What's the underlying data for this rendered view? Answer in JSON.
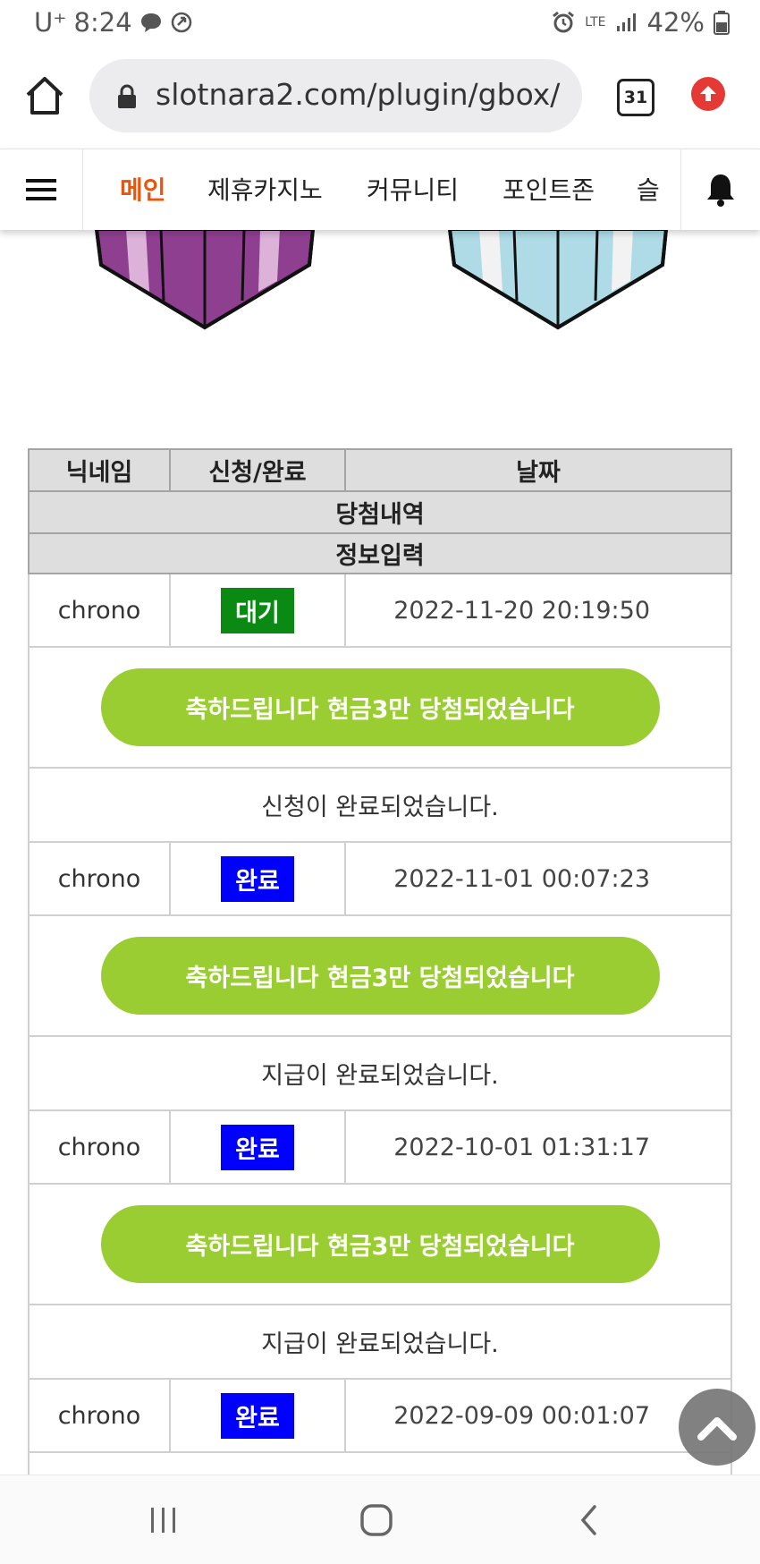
{
  "status_bar": {
    "carrier": "U⁺",
    "time": "8:24",
    "network": "LTE",
    "battery": "42%"
  },
  "browser": {
    "url": "slotnara2.com/plugin/gbox/",
    "tab_count": "31"
  },
  "nav": {
    "items": [
      "메인",
      "제휴카지노",
      "커뮤니티",
      "포인트존",
      "슬"
    ],
    "active_index": 0
  },
  "table": {
    "headers": {
      "nickname": "닉네임",
      "status": "신청/완료",
      "date": "날짜",
      "history": "당첨내역",
      "info": "정보입력"
    },
    "entries": [
      {
        "nickname": "chrono",
        "status": "대기",
        "status_type": "wait",
        "date": "2022-11-20 20:19:50",
        "prize": "축하드립니다 현금3만 당첨되었습니다",
        "message": "신청이 완료되었습니다."
      },
      {
        "nickname": "chrono",
        "status": "완료",
        "status_type": "done",
        "date": "2022-11-01 00:07:23",
        "prize": "축하드립니다 현금3만 당첨되었습니다",
        "message": "지급이 완료되었습니다."
      },
      {
        "nickname": "chrono",
        "status": "완료",
        "status_type": "done",
        "date": "2022-10-01 01:31:17",
        "prize": "축하드립니다 현금3만 당첨되었습니다",
        "message": "지급이 완료되었습니다."
      },
      {
        "nickname": "chrono",
        "status": "완료",
        "status_type": "done",
        "date": "2022-09-09 00:01:07"
      }
    ]
  },
  "colors": {
    "accent": "#e8550c",
    "prize_green": "#9acd32",
    "wait_green": "#0b8a13",
    "done_blue": "#0000ff",
    "box_purple": "#8e3f8f",
    "box_blue": "#aedbe6"
  }
}
